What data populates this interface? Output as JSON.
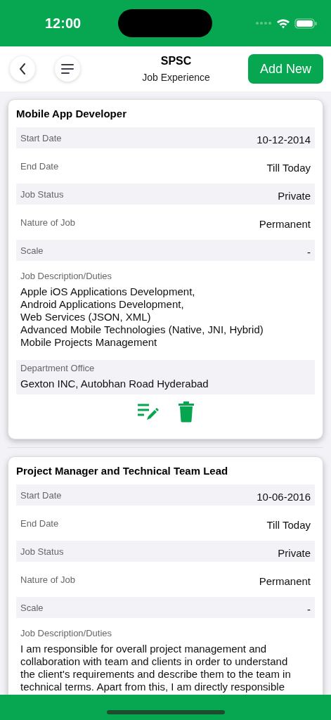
{
  "status_bar": {
    "time": "12:00"
  },
  "header": {
    "title": "SPSC",
    "subtitle": "Job Experience",
    "action": "Add New"
  },
  "jobs": [
    {
      "title": "Mobile App Developer",
      "fields": [
        {
          "label": "Start Date",
          "value": "10-12-2014"
        },
        {
          "label": "End Date",
          "value": "Till Today"
        },
        {
          "label": "Job Status",
          "value": "Private"
        },
        {
          "label": "Nature of Job",
          "value": "Permanent"
        },
        {
          "label": "Scale",
          "value": "-"
        }
      ],
      "description_label": "Job Description/Duties",
      "description_lines": [
        "Apple iOS Applications Development,",
        "Android Applications Development,",
        "Web Services (JSON, XML)",
        "Advanced Mobile Technologies (Native, JNI, Hybrid)",
        "Mobile Projects Management"
      ],
      "office_label": "Department Office",
      "office": "Gexton INC, Autobhan Road Hyderabad"
    },
    {
      "title": "Project Manager and Technical Team Lead",
      "fields": [
        {
          "label": "Start Date",
          "value": "10-06-2016"
        },
        {
          "label": "End Date",
          "value": "Till Today"
        },
        {
          "label": "Job Status",
          "value": "Private"
        },
        {
          "label": "Nature of Job",
          "value": "Permanent"
        },
        {
          "label": "Scale",
          "value": "-"
        }
      ],
      "description_label": "Job Description/Duties",
      "description_lines": [
        "I am responsible for overall project management and",
        "collaboration with team and clients in order to understand",
        "the client's requirements and describe them to the team in",
        "technical terms. Apart from this, I am directly responsible"
      ]
    }
  ]
}
